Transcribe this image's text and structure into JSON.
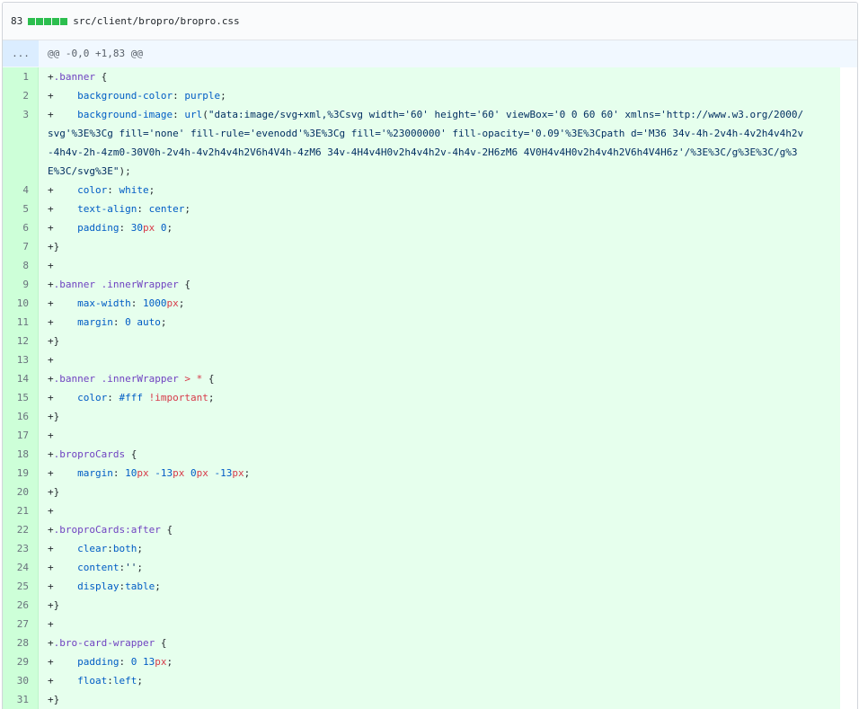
{
  "file_header": {
    "additions_count": "83",
    "path": "src/client/bropro/bropro.css",
    "diffstat_blocks": 5,
    "diffstat_color": "#2cbe4e"
  },
  "hunk": {
    "expand_label": "...",
    "header": "@@ -0,0 +1,83 @@"
  },
  "lines": [
    {
      "n": "1",
      "t": "+.banner {"
    },
    {
      "n": "2",
      "t": "+    background-color: purple;"
    },
    {
      "n": "3",
      "t": "+    background-image: url(\"data:image/svg+xml,%3Csvg width='60' height='60' viewBox='0 0 60 60' xmlns='http://www.w3.org/2000/svg'%3E%3Cg fill='none' fill-rule='evenodd'%3E%3Cg fill='%23000000' fill-opacity='0.09'%3E%3Cpath d='M36 34v-4h-2v4h-4v2h4v4h2v-4h4v-2h-4zm0-30V0h-2v4h-4v2h4v4h2V6h4V4h-4zM6 34v-4H4v4H0v2h4v4h2v-4h4v-2H6zM6 4V0H4v4H0v2h4v4h2V6h4V4H6z'/%3E%3C/g%3E%3C/g%3E%3C/svg%3E\");"
    },
    {
      "n": "4",
      "t": "+    color: white;"
    },
    {
      "n": "5",
      "t": "+    text-align: center;"
    },
    {
      "n": "6",
      "t": "+    padding: 30px 0;"
    },
    {
      "n": "7",
      "t": "+}"
    },
    {
      "n": "8",
      "t": "+"
    },
    {
      "n": "9",
      "t": "+.banner .innerWrapper {"
    },
    {
      "n": "10",
      "t": "+    max-width: 1000px;"
    },
    {
      "n": "11",
      "t": "+    margin: 0 auto;"
    },
    {
      "n": "12",
      "t": "+}"
    },
    {
      "n": "13",
      "t": "+"
    },
    {
      "n": "14",
      "t": "+.banner .innerWrapper > * {"
    },
    {
      "n": "15",
      "t": "+    color: #fff !important;"
    },
    {
      "n": "16",
      "t": "+}"
    },
    {
      "n": "17",
      "t": "+"
    },
    {
      "n": "18",
      "t": "+.broproCards {"
    },
    {
      "n": "19",
      "t": "+    margin: 10px -13px 0px -13px;"
    },
    {
      "n": "20",
      "t": "+}"
    },
    {
      "n": "21",
      "t": "+"
    },
    {
      "n": "22",
      "t": "+.broproCards:after {"
    },
    {
      "n": "23",
      "t": "+    clear:both;"
    },
    {
      "n": "24",
      "t": "+    content:'';"
    },
    {
      "n": "25",
      "t": "+    display:table;"
    },
    {
      "n": "26",
      "t": "+}"
    },
    {
      "n": "27",
      "t": "+"
    },
    {
      "n": "28",
      "t": "+.bro-card-wrapper {"
    },
    {
      "n": "29",
      "t": "+    padding: 0 13px;"
    },
    {
      "n": "30",
      "t": "+    float:left;"
    },
    {
      "n": "31",
      "t": "+}"
    }
  ],
  "colors": {
    "addition_line_bg": "#e6ffed",
    "addition_number_bg": "#cdffd8",
    "hunk_bg": "#f1f8ff",
    "selector": "#6f42c1",
    "property": "#005cc5",
    "unit": "#d73a49"
  }
}
